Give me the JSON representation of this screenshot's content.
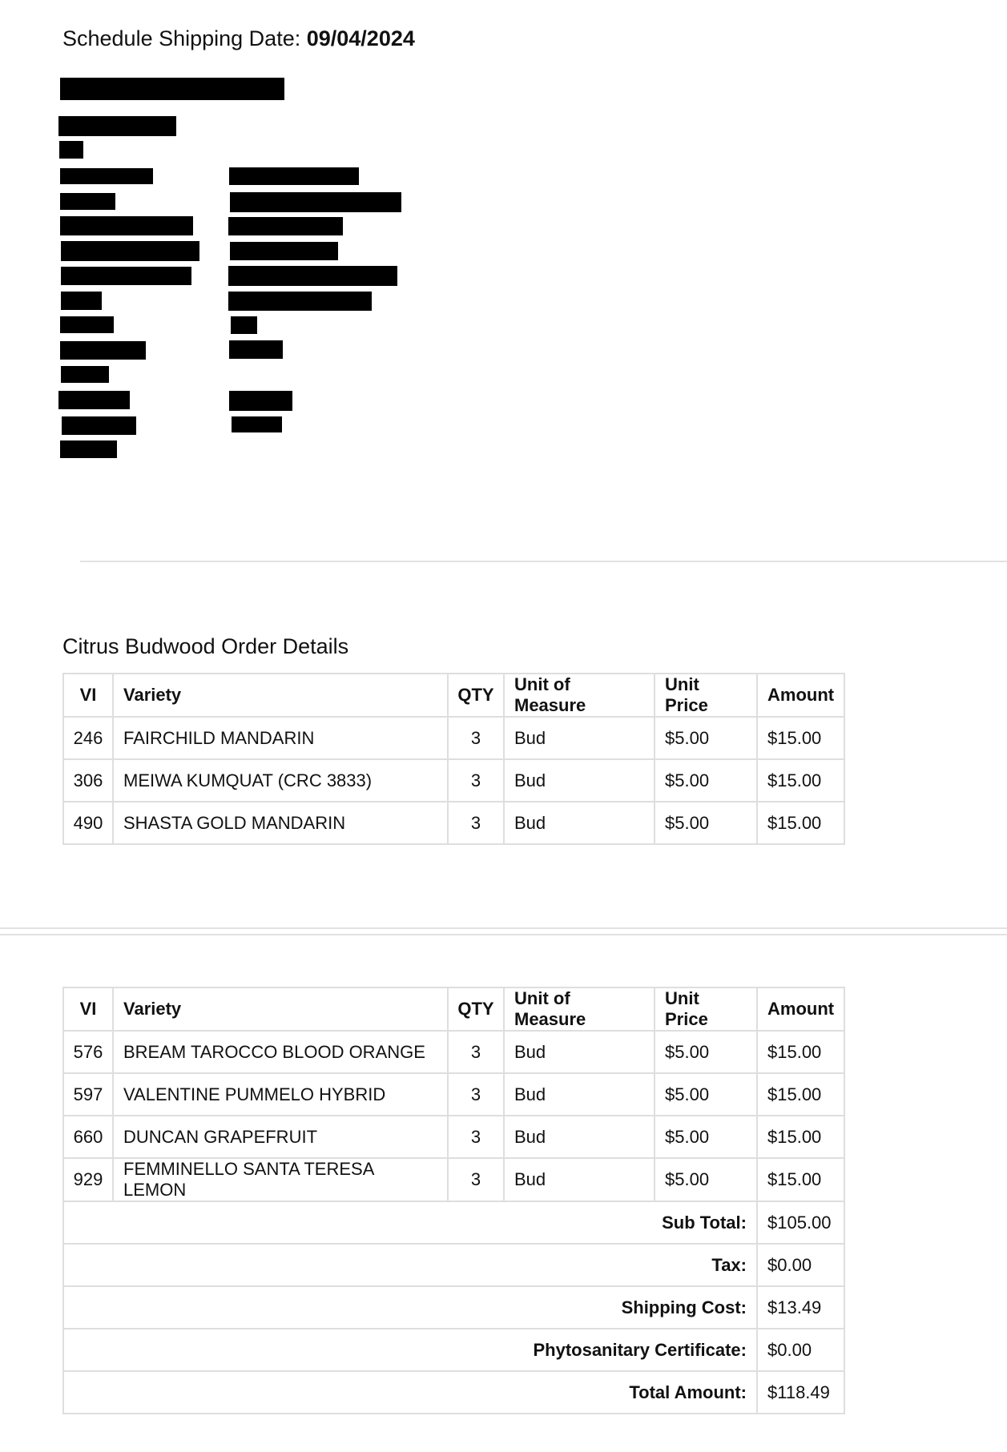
{
  "schedule": {
    "label": "Schedule Shipping Date:",
    "date": "09/04/2024"
  },
  "section_title": "Citrus Budwood Order Details",
  "table_headers": {
    "vi": "VI",
    "variety": "Variety",
    "qty": "QTY",
    "uom": "Unit of Measure",
    "unit_price": "Unit Price",
    "amount": "Amount"
  },
  "table1": {
    "rows": [
      {
        "vi": "246",
        "variety": "FAIRCHILD MANDARIN",
        "qty": "3",
        "uom": "Bud",
        "unit_price": "$5.00",
        "amount": "$15.00"
      },
      {
        "vi": "306",
        "variety": "MEIWA KUMQUAT (CRC 3833)",
        "qty": "3",
        "uom": "Bud",
        "unit_price": "$5.00",
        "amount": "$15.00"
      },
      {
        "vi": "490",
        "variety": "SHASTA GOLD MANDARIN",
        "qty": "3",
        "uom": "Bud",
        "unit_price": "$5.00",
        "amount": "$15.00"
      }
    ]
  },
  "table2": {
    "rows": [
      {
        "vi": "576",
        "variety": "BREAM TAROCCO BLOOD ORANGE",
        "qty": "3",
        "uom": "Bud",
        "unit_price": "$5.00",
        "amount": "$15.00"
      },
      {
        "vi": "597",
        "variety": "VALENTINE PUMMELO HYBRID",
        "qty": "3",
        "uom": "Bud",
        "unit_price": "$5.00",
        "amount": "$15.00"
      },
      {
        "vi": "660",
        "variety": "DUNCAN GRAPEFRUIT",
        "qty": "3",
        "uom": "Bud",
        "unit_price": "$5.00",
        "amount": "$15.00"
      },
      {
        "vi": "929",
        "variety": "FEMMINELLO SANTA TERESA LEMON",
        "qty": "3",
        "uom": "Bud",
        "unit_price": "$5.00",
        "amount": "$15.00"
      }
    ],
    "summary": [
      {
        "label": "Sub Total:",
        "value": "$105.00"
      },
      {
        "label": "Tax:",
        "value": "$0.00"
      },
      {
        "label": "Shipping Cost:",
        "value": "$13.49"
      },
      {
        "label": "Phytosanitary Certificate:",
        "value": "$0.00"
      },
      {
        "label": "Total Amount:",
        "value": "$118.49"
      }
    ]
  }
}
